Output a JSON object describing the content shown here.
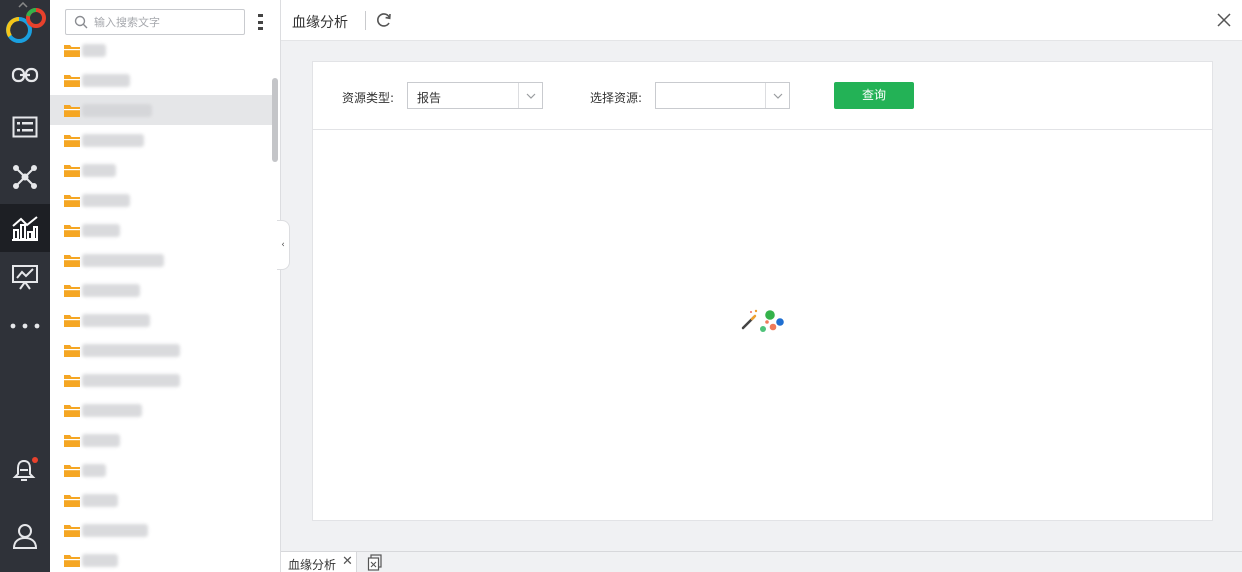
{
  "search": {
    "placeholder": "输入搜索文字"
  },
  "title": "血缘分析",
  "filters": {
    "resource_type_label": "资源类型:",
    "resource_type_value": "报告",
    "select_resource_label": "选择资源:",
    "select_resource_value": "",
    "query_label": "查询"
  },
  "tabs": [
    {
      "label": "血缘分析",
      "close": "✕"
    }
  ],
  "colors": {
    "accent_green": "#23b256",
    "rail_bg": "#2f3239",
    "folder": "#f5a623"
  }
}
